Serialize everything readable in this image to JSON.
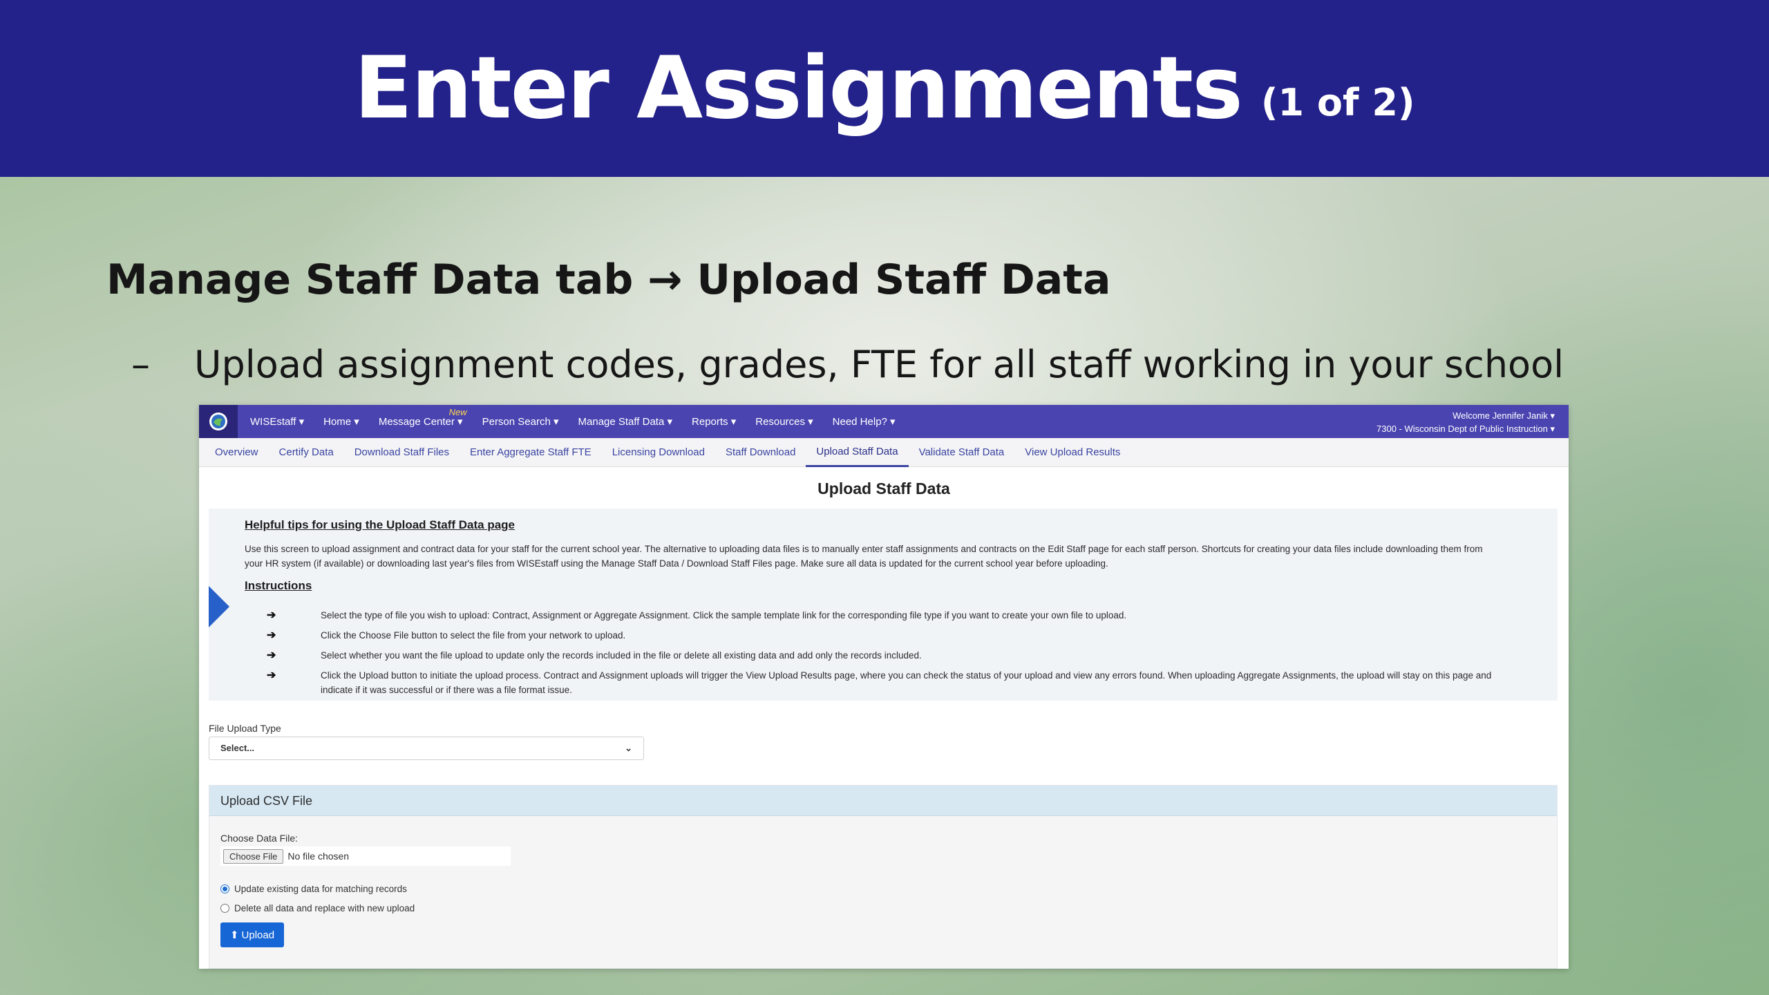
{
  "slide": {
    "title": "Enter Assignments",
    "title_suffix": "(1 of 2)",
    "heading": "Manage Staff Data tab → Upload Staff Data",
    "bullet_dash": "–",
    "bullet_text": "Upload assignment codes, grades, FTE for all staff working in your school"
  },
  "topnav": {
    "items": [
      {
        "label": "WISEstaff ▾"
      },
      {
        "label": "Home ▾"
      },
      {
        "label": "Message Center ▾",
        "badge": "New"
      },
      {
        "label": "Person Search ▾"
      },
      {
        "label": "Manage Staff Data ▾"
      },
      {
        "label": "Reports ▾"
      },
      {
        "label": "Resources ▾"
      },
      {
        "label": "Need Help? ▾"
      }
    ],
    "welcome_line1": "Welcome Jennifer Janik ▾",
    "welcome_line2": "7300 - Wisconsin Dept of Public Instruction ▾"
  },
  "subnav": {
    "items": [
      {
        "label": "Overview"
      },
      {
        "label": "Certify Data"
      },
      {
        "label": "Download Staff Files"
      },
      {
        "label": "Enter Aggregate Staff FTE"
      },
      {
        "label": "Licensing Download"
      },
      {
        "label": "Staff Download"
      },
      {
        "label": "Upload Staff Data",
        "active": true
      },
      {
        "label": "Validate Staff Data"
      },
      {
        "label": "View Upload Results"
      }
    ]
  },
  "page_title": "Upload Staff Data",
  "tips": {
    "title": "Helpful tips for using the Upload Staff Data page",
    "text": "Use this screen to upload assignment and contract data for your staff for the current school year. The alternative to uploading data files is to manually enter staff assignments and contracts on the Edit Staff page for each staff person. Shortcuts for creating your data files include downloading them from your HR system (if available) or downloading last year's files from WISEstaff using the Manage Staff Data / Download Staff Files page. Make sure all data is updated for the current school year before uploading.",
    "instructions_title": "Instructions",
    "instructions": [
      "Select the type of file you wish to upload: Contract, Assignment or Aggregate Assignment. Click the sample template link for the corresponding file type if you want to create your own file to upload.",
      "Click the Choose File button to select the file from your network to upload.",
      "Select whether you want the file upload to update only the records included in the file or delete all existing data and add only the records included.",
      "Click the Upload button to initiate the upload process. Contract and Assignment uploads will trigger the View Upload Results page, where you can check the status of your upload and view any errors found. When uploading Aggregate Assignments, the upload will stay on this page and indicate if it was successful or if there was a file format issue."
    ]
  },
  "file_upload_type": {
    "label": "File Upload Type",
    "selected": "Select..."
  },
  "csv": {
    "header": "Upload CSV File",
    "choose_label": "Choose Data File:",
    "choose_button": "Choose File",
    "no_file": "No file chosen",
    "option_update": "Update existing data for matching records",
    "option_delete": "Delete all data and replace with new upload",
    "upload_button": "Upload"
  },
  "colors": {
    "title_bar": "#23218a",
    "nav": "#4a44b0",
    "accent": "#1766d6"
  }
}
